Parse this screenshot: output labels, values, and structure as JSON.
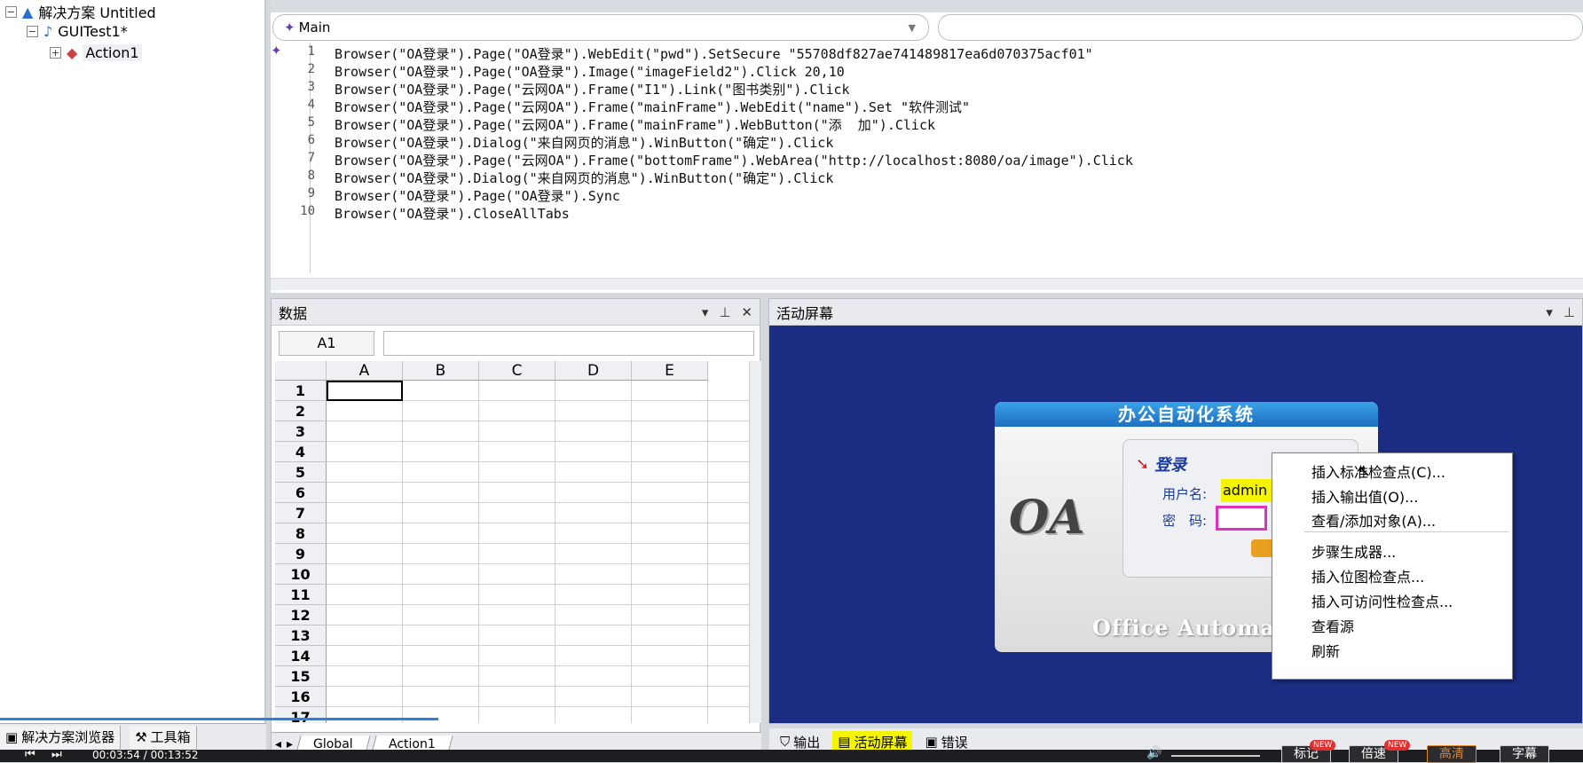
{
  "tree": {
    "solution": "解决方案 Untitled",
    "test": "GUITest1*",
    "action": "Action1"
  },
  "left_tabs": {
    "solution_explorer": "解决方案浏览器",
    "toolbox": "工具箱"
  },
  "editor": {
    "dropdown": "Main",
    "lines": [
      {
        "n": "1",
        "text": "Browser(\"OA登录\").Page(\"OA登录\").WebEdit(\"pwd\").SetSecure \"55708df827ae741489817ea6d070375acf01\""
      },
      {
        "n": "2",
        "text": "Browser(\"OA登录\").Page(\"OA登录\").Image(\"imageField2\").Click 20,10"
      },
      {
        "n": "3",
        "text": "Browser(\"OA登录\").Page(\"云网OA\").Frame(\"I1\").Link(\"图书类别\").Click"
      },
      {
        "n": "4",
        "text": "Browser(\"OA登录\").Page(\"云网OA\").Frame(\"mainFrame\").WebEdit(\"name\").Set \"软件测试\""
      },
      {
        "n": "5",
        "text": "Browser(\"OA登录\").Page(\"云网OA\").Frame(\"mainFrame\").WebButton(\"添  加\").Click"
      },
      {
        "n": "6",
        "text": "Browser(\"OA登录\").Dialog(\"来自网页的消息\").WinButton(\"确定\").Click"
      },
      {
        "n": "7",
        "text": "Browser(\"OA登录\").Page(\"云网OA\").Frame(\"bottomFrame\").WebArea(\"http://localhost:8080/oa/image\").Click"
      },
      {
        "n": "8",
        "text": "Browser(\"OA登录\").Dialog(\"来自网页的消息\").WinButton(\"确定\").Click"
      },
      {
        "n": "9",
        "text": "Browser(\"OA登录\").Page(\"OA登录\").Sync"
      },
      {
        "n": "10",
        "text": "Browser(\"OA登录\").CloseAllTabs"
      }
    ]
  },
  "data_panel": {
    "title": "数据",
    "cell_ref": "A1",
    "columns": [
      "A",
      "B",
      "C",
      "D",
      "E"
    ],
    "rows": [
      "1",
      "2",
      "3",
      "4",
      "5",
      "6",
      "7",
      "8",
      "9",
      "10",
      "11",
      "12",
      "13",
      "14",
      "15",
      "16",
      "17"
    ],
    "sheets": [
      "Global",
      "Action1"
    ]
  },
  "active_screen": {
    "title": "活动屏幕",
    "oa_title": "办公自动化系统",
    "login_label": "登录",
    "username_label": "用户名:",
    "username_value": "admin",
    "password_label": "密　码:",
    "logo": "OA",
    "footer": "Office Automatio",
    "context_menu": [
      "插入标准检查点(C)...",
      "插入输出值(O)...",
      "查看/添加对象(A)...",
      "步骤生成器...",
      "插入位图检查点...",
      "插入可访问性检查点...",
      "查看源",
      "刷新"
    ],
    "tabs": [
      "输出",
      "活动屏幕",
      "错误"
    ]
  },
  "player": {
    "time": "00:03:54 / 00:13:52",
    "buttons": [
      "标记",
      "倍速",
      "高清",
      "字幕"
    ],
    "badge": "NEW"
  },
  "colors": {
    "accent_blue": "#2f7fe0",
    "highlight_yellow": "#f5f500",
    "active_screen_bg": "#1b2d83"
  }
}
